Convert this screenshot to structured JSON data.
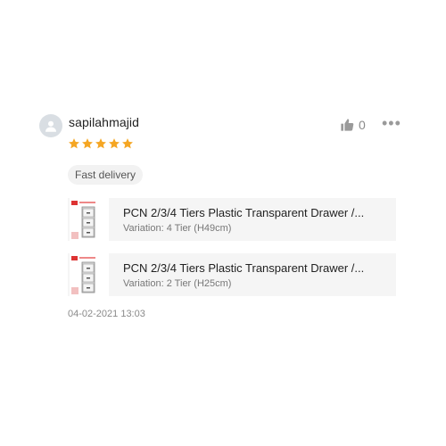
{
  "review": {
    "username": "sapilahmajid",
    "rating": 5,
    "like_count": "0",
    "tag": "Fast delivery",
    "date": "04-02-2021 13:03",
    "star_color": "#f5a623"
  },
  "products": [
    {
      "title": "PCN 2/3/4 Tiers Plastic Transparent Drawer /...",
      "variation": "Variation: 4 Tier (H49cm)"
    },
    {
      "title": "PCN 2/3/4 Tiers Plastic Transparent Drawer /...",
      "variation": "Variation: 2 Tier (H25cm)"
    }
  ],
  "icons": {
    "avatar": "user-icon",
    "like": "thumbs-up-icon",
    "more": "more-options-icon",
    "star": "star-icon"
  }
}
